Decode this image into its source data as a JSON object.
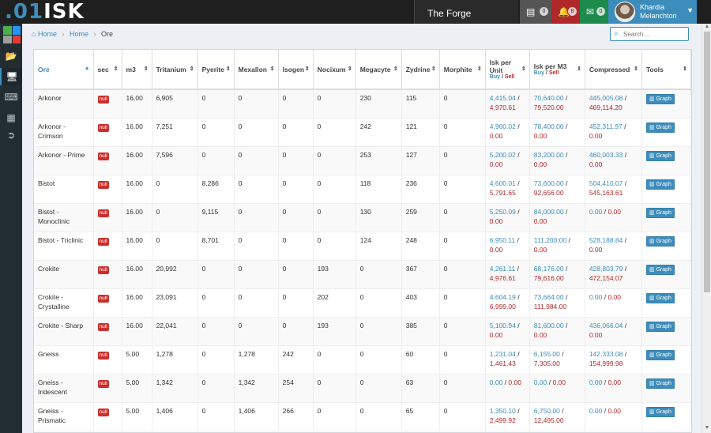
{
  "app": {
    "logo_dot": ".01",
    "logo_text": "ISK"
  },
  "topbar": {
    "region": "The Forge",
    "list_badge": "0",
    "bell_badge": "8",
    "mail_badge": "0",
    "user_first": "Khardia",
    "user_last": "Melanchton"
  },
  "breadcrumb": {
    "home1": "Home",
    "home2": "Home",
    "current": "Ore"
  },
  "search": {
    "placeholder": "Search ..."
  },
  "table": {
    "headers": {
      "ore": "Ore",
      "sec": "sec",
      "m3": "m3",
      "tritanium": "Tritanium",
      "pyerite": "Pyerite",
      "mexallon": "Mexallon",
      "isogen": "Isogen",
      "nocixum": "Nocixum",
      "megacyte": "Megacyte",
      "zydrine": "Zydrine",
      "morphite": "Morphite",
      "isk_unit": "Isk per Unit",
      "isk_m3": "Isk per M3",
      "compressed": "Compressed",
      "tools": "Tools",
      "buy": "Buy",
      "slash": " / ",
      "sell": "Sell"
    },
    "null_label": "null",
    "graph_label": "Graph",
    "rows": [
      {
        "ore": "Arkonor",
        "m3": "16.00",
        "trit": "6,905",
        "pye": "0",
        "mex": "0",
        "iso": "0",
        "noc": "0",
        "mega": "230",
        "zyd": "115",
        "mor": "0",
        "u_buy": "4,415.04",
        "u_sell": "4,970.61",
        "m_buy": "70,640.00",
        "m_sell": "79,520.00",
        "c_buy": "445,005.08",
        "c_sell": "469,114.20"
      },
      {
        "ore": "Arkonor - Crimson",
        "m3": "16.00",
        "trit": "7,251",
        "pye": "0",
        "mex": "0",
        "iso": "0",
        "noc": "0",
        "mega": "242",
        "zyd": "121",
        "mor": "0",
        "u_buy": "4,900.02",
        "u_sell": "0.00",
        "m_buy": "78,400.00",
        "m_sell": "0.00",
        "c_buy": "452,311.97",
        "c_sell": "0.00"
      },
      {
        "ore": "Arkonor - Prime",
        "m3": "16.00",
        "trit": "7,596",
        "pye": "0",
        "mex": "0",
        "iso": "0",
        "noc": "0",
        "mega": "253",
        "zyd": "127",
        "mor": "0",
        "u_buy": "5,200.02",
        "u_sell": "0.00",
        "m_buy": "83,200.00",
        "m_sell": "0.00",
        "c_buy": "460,003.33",
        "c_sell": "0.00"
      },
      {
        "ore": "Bistot",
        "m3": "16.00",
        "trit": "0",
        "pye": "8,286",
        "mex": "0",
        "iso": "0",
        "noc": "0",
        "mega": "118",
        "zyd": "236",
        "mor": "0",
        "u_buy": "4,600.01",
        "u_sell": "5,791.65",
        "m_buy": "73,600.00",
        "m_sell": "92,656.00",
        "c_buy": "504,410.07",
        "c_sell": "545,163.61"
      },
      {
        "ore": "Bistot - Monoclinic",
        "m3": "16.00",
        "trit": "0",
        "pye": "9,115",
        "mex": "0",
        "iso": "0",
        "noc": "0",
        "mega": "130",
        "zyd": "259",
        "mor": "0",
        "u_buy": "5,250.09",
        "u_sell": "0.00",
        "m_buy": "84,000.00",
        "m_sell": "0.00",
        "c_buy": "0.00",
        "c_sell": "0.00",
        "c_inline": true
      },
      {
        "ore": "Bistot - Triclinic",
        "m3": "16.00",
        "trit": "0",
        "pye": "8,701",
        "mex": "0",
        "iso": "0",
        "noc": "0",
        "mega": "124",
        "zyd": "248",
        "mor": "0",
        "u_buy": "6,950.11",
        "u_sell": "0.00",
        "m_buy": "111,200.00",
        "m_sell": "0.00",
        "c_buy": "528,188.84",
        "c_sell": "0.00"
      },
      {
        "ore": "Crokite",
        "m3": "16.00",
        "trit": "20,992",
        "pye": "0",
        "mex": "0",
        "iso": "0",
        "noc": "193",
        "mega": "0",
        "zyd": "367",
        "mor": "0",
        "u_buy": "4,261.11",
        "u_sell": "4,976.61",
        "m_buy": "68,176.00",
        "m_sell": "79,616.00",
        "c_buy": "428,803.79",
        "c_sell": "472,154.07"
      },
      {
        "ore": "Crokite - Crystalline",
        "m3": "16.00",
        "trit": "23,091",
        "pye": "0",
        "mex": "0",
        "iso": "0",
        "noc": "202",
        "mega": "0",
        "zyd": "403",
        "mor": "0",
        "u_buy": "4,604.19",
        "u_sell": "6,999.00",
        "m_buy": "73,664.00",
        "m_sell": "111,984.00",
        "c_buy": "0.00",
        "c_sell": "0.00",
        "c_inline": true
      },
      {
        "ore": "Crokite - Sharp",
        "m3": "16.00",
        "trit": "22,041",
        "pye": "0",
        "mex": "0",
        "iso": "0",
        "noc": "193",
        "mega": "0",
        "zyd": "385",
        "mor": "0",
        "u_buy": "5,100.94",
        "u_sell": "0.00",
        "m_buy": "81,600.00",
        "m_sell": "0.00",
        "c_buy": "436,066.04",
        "c_sell": "0.00"
      },
      {
        "ore": "Gneiss",
        "m3": "5.00",
        "trit": "1,278",
        "pye": "0",
        "mex": "1,278",
        "iso": "242",
        "noc": "0",
        "mega": "0",
        "zyd": "60",
        "mor": "0",
        "u_buy": "1,231.04",
        "u_sell": "1,461.43",
        "m_buy": "6,155.00",
        "m_sell": "7,305.00",
        "c_buy": "142,333.08",
        "c_sell": "154,999.98"
      },
      {
        "ore": "Gneiss - Iridescent",
        "m3": "5.00",
        "trit": "1,342",
        "pye": "0",
        "mex": "1,342",
        "iso": "254",
        "noc": "0",
        "mega": "0",
        "zyd": "63",
        "mor": "0",
        "u_buy": "0.00",
        "u_sell": "0.00",
        "m_buy": "0.00",
        "m_sell": "0.00",
        "c_buy": "0.00",
        "c_sell": "0.00",
        "u_inline": true,
        "m_inline": true,
        "c_inline": true
      },
      {
        "ore": "Gneiss - Prismatic",
        "m3": "5.00",
        "trit": "1,406",
        "pye": "0",
        "mex": "1,406",
        "iso": "266",
        "noc": "0",
        "mega": "0",
        "zyd": "65",
        "mor": "0",
        "u_buy": "1,350.10",
        "u_sell": "2,499.92",
        "m_buy": "6,750.00",
        "m_sell": "12,495.00",
        "c_buy": "0.00",
        "c_sell": "0.00",
        "c_inline": true
      }
    ]
  }
}
